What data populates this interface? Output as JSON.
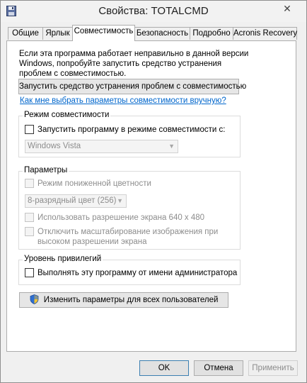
{
  "window": {
    "title": "Свойства: TOTALCMD",
    "close_glyph": "✕"
  },
  "tabs": [
    {
      "label": "Общие"
    },
    {
      "label": "Ярлык"
    },
    {
      "label": "Совместимость"
    },
    {
      "label": "Безопасность"
    },
    {
      "label": "Подробно"
    },
    {
      "label": "Acronis Recovery"
    }
  ],
  "active_tab": "Совместимость",
  "intro_lines": [
    "Если эта программа работает неправильно в данной версии",
    "Windows, попробуйте запустить средство устранения",
    "проблем с совместимостью."
  ],
  "troubleshooter_button": "Запустить средство устранения проблем с совместимостью",
  "manual_link": "Как мне выбрать параметры совместимости вручную?",
  "compat_mode": {
    "group_label": "Режим совместимости",
    "checkbox_label": "Запустить программу в режиме совместимости с:",
    "checked": false,
    "os_select_value": "Windows Vista"
  },
  "settings": {
    "group_label": "Параметры",
    "reduced_color_label": "Режим пониженной цветности",
    "color_select_value": "8-разрядный цвет (256)",
    "resolution_label": "Использовать разрешение экрана 640 х 480",
    "scaling_label_line1": "Отключить масштабирование изображения при",
    "scaling_label_line2": "высоком разрешении экрана"
  },
  "privilege": {
    "group_label": "Уровень привилегий",
    "admin_label": "Выполнять эту программу от имени администратора",
    "checked": false
  },
  "all_users_button": "Изменить параметры для всех пользователей",
  "buttons": {
    "ok": "OK",
    "cancel": "Отмена",
    "apply": "Применить"
  },
  "colors": {
    "accent_link": "#0066cc",
    "default_button_border": "#3c7fb1"
  },
  "icons": {
    "title": "floppy-disk-icon",
    "close": "close-icon",
    "uac": "uac-shield-icon"
  }
}
